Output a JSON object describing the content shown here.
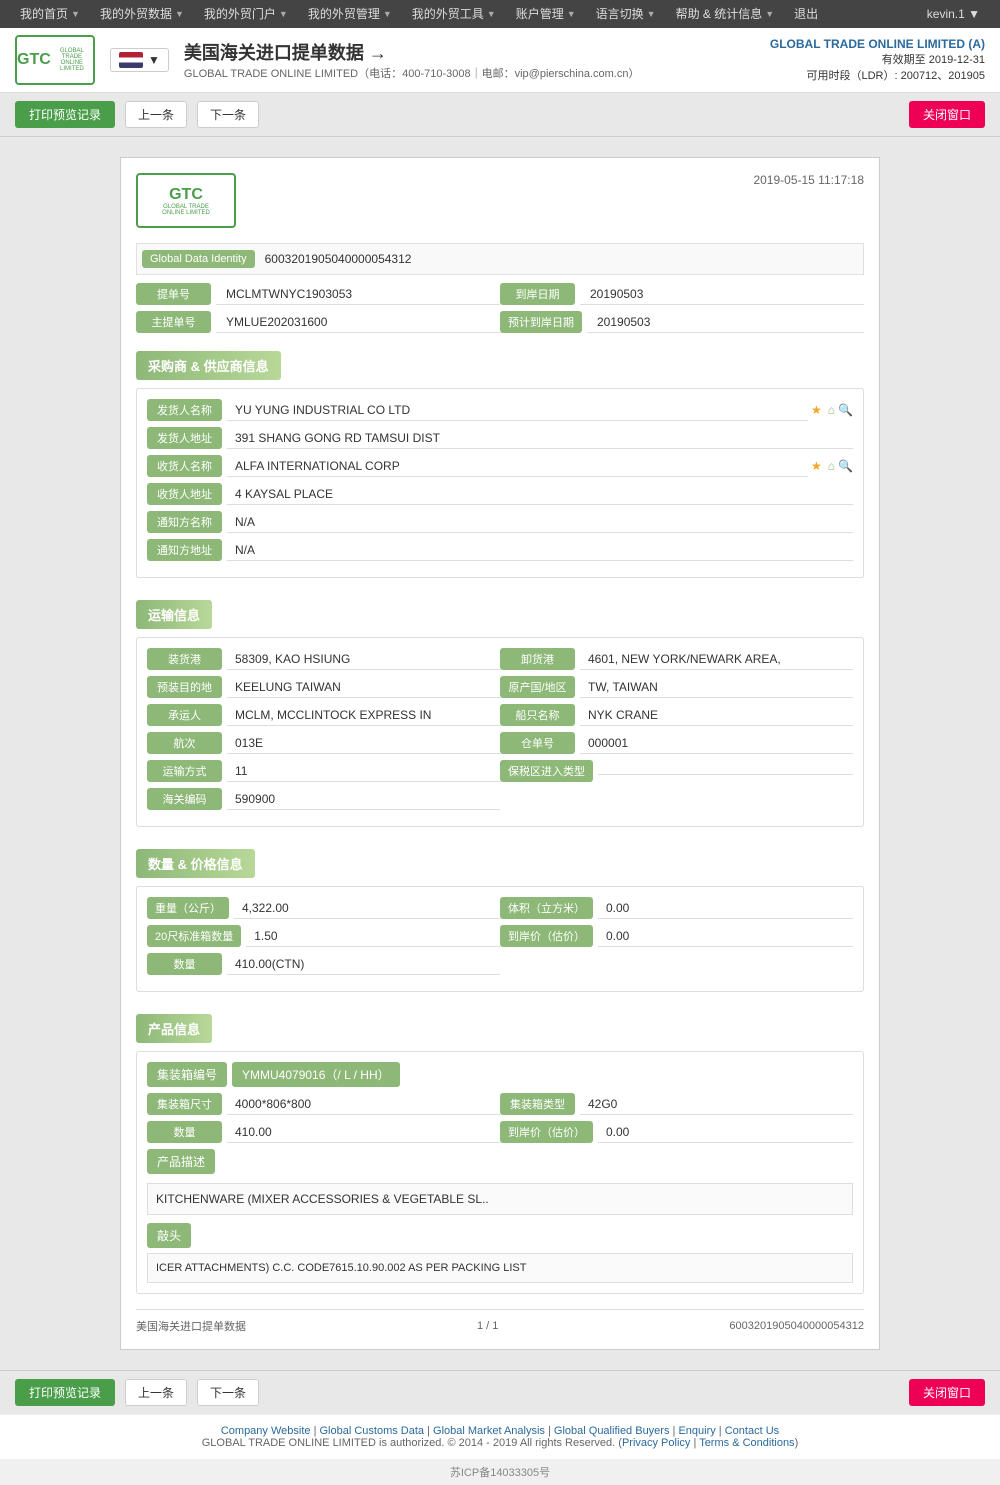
{
  "topnav": {
    "items": [
      "我的首页",
      "我的外贸数据",
      "我的外贸门户",
      "我的外贸管理",
      "我的外贸工具",
      "账户管理",
      "语言切换",
      "帮助 & 统计信息",
      "退出"
    ],
    "user": "kevin.1 ▼"
  },
  "header": {
    "title": "美国海关进口提单数据",
    "subtitle": "GLOBAL TRADE ONLINE LIMITED（电话：400-710-3008｜电邮：vip@pierschina.com.cn）",
    "company": "GLOBAL TRADE ONLINE LIMITED (A)",
    "valid_until": "有效期至 2019-12-31",
    "ldr": "可用时段（LDR）: 200712、201905"
  },
  "toolbar": {
    "print_label": "打印预览记录",
    "prev_label": "上一条",
    "next_label": "下一条",
    "close_label": "关闭窗口"
  },
  "document": {
    "datetime": "2019-05-15 11:17:18",
    "global_data_identity_label": "Global Data Identity",
    "global_data_identity_value": "6003201905040000054312",
    "ti_dan_hao_label": "提单号",
    "ti_dan_hao_value": "MCLMTWNYC1903053",
    "dao_gang_ri_qi_label": "到岸日期",
    "dao_gang_ri_qi_value": "20190503",
    "zhu_ti_dan_hao_label": "主提单号",
    "zhu_ti_dan_hao_value": "YMLUE202031600",
    "yu_ji_dao_gang_label": "预计到岸日期",
    "yu_ji_dao_gang_value": "20190503",
    "supplier_section": "采购商 & 供应商信息",
    "fa_huo_ren_mc_label": "发货人名称",
    "fa_huo_ren_mc_value": "YU YUNG INDUSTRIAL CO LTD",
    "fa_huo_ren_dz_label": "发货人地址",
    "fa_huo_ren_dz_value": "391 SHANG GONG RD TAMSUI DIST",
    "shou_huo_ren_mc_label": "收货人名称",
    "shou_huo_ren_mc_value": "ALFA INTERNATIONAL CORP",
    "shou_huo_ren_dz_label": "收货人地址",
    "shou_huo_ren_dz_value": "4 KAYSAL PLACE",
    "tong_zhi_fang_mc_label": "通知方名称",
    "tong_zhi_fang_mc_value": "N/A",
    "tong_zhi_fang_dz_label": "通知方地址",
    "tong_zhi_fang_dz_value": "N/A",
    "transport_section": "运输信息",
    "zhuang_huo_gang_label": "装货港",
    "zhuang_huo_gang_value": "58309, KAO HSIUNG",
    "xie_huo_gang_label": "卸货港",
    "xie_huo_gang_value": "4601, NEW YORK/NEWARK AREA,",
    "yu_zhuang_mu_di_label": "预装目的地",
    "yu_zhuang_mu_di_value": "KEELUNG TAIWAN",
    "chan_di_di_qu_label": "原产国/地区",
    "chan_di_di_qu_value": "TW, TAIWAN",
    "cheng_yun_ren_label": "承运人",
    "cheng_yun_ren_value": "MCLM, MCCLINTOCK EXPRESS IN",
    "chuan_ming_label": "船只名称",
    "chuan_ming_value": "NYK CRANE",
    "hang_ci_label": "航次",
    "hang_ci_value": "013E",
    "cang_dan_hao_label": "仓单号",
    "cang_dan_hao_value": "000001",
    "yun_shu_fang_shi_label": "运输方式",
    "yun_shu_fang_shi_value": "11",
    "bao_shui_qu_label": "保税区进入类型",
    "bao_shui_qu_value": "",
    "hai_guan_label": "海关编码",
    "hai_guan_value": "590900",
    "quantity_section": "数量 & 价格信息",
    "zhong_liang_label": "重量（公斤）",
    "zhong_liang_value": "4,322.00",
    "ti_ji_label": "体积（立方米）",
    "ti_ji_value": "0.00",
    "standard_20_label": "20尺标准箱数量",
    "standard_20_value": "1.50",
    "dao_an_jia_label": "到岸价（估价）",
    "dao_an_jia_value": "0.00",
    "shu_liang_label": "数量",
    "shu_liang_value": "410.00(CTN)",
    "product_section": "产品信息",
    "container_no_label": "集装箱编号",
    "container_no_value": "YMMU4079016（/ L / HH）",
    "container_size_label": "集装箱尺寸",
    "container_size_value": "4000*806*800",
    "container_type_label": "集装箱类型",
    "container_type_value": "42G0",
    "product_qty_label": "数量",
    "product_qty_value": "410.00",
    "product_price_label": "到岸价（估价）",
    "product_price_value": "0.00",
    "product_desc_label": "产品描述",
    "product_desc_value": "KITCHENWARE (MIXER ACCESSORIES & VEGETABLE SL..",
    "heads_label": "敲头",
    "heads_value": "ICER ATTACHMENTS) C.C. CODE7615.10.90.002 AS PER PACKING LIST",
    "footer_title": "美国海关进口提单数据",
    "footer_page": "1 / 1",
    "footer_id": "6003201905040000054312"
  },
  "page_footer": {
    "links": [
      "Company Website",
      "Global Customs Data",
      "Global Market Analysis",
      "Global Qualified Buyers",
      "Enquiry",
      "Contact Us"
    ],
    "copyright": "GLOBAL TRADE ONLINE LIMITED is authorized. © 2014 - 2019 All rights Reserved.",
    "privacy": "Privacy Policy",
    "terms": "Terms & Conditions"
  },
  "icp": "苏ICP备14033305号"
}
